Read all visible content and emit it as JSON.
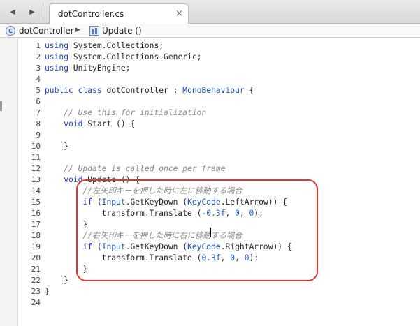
{
  "tab": {
    "filename": "dotController.cs",
    "close": "×"
  },
  "nav": {
    "back": "◀",
    "forward": "▶"
  },
  "breadcrumb": {
    "class_name": "dotController",
    "separator": "▶",
    "method_name": "Update ()"
  },
  "colors": {
    "keyword": "#1d3fbf",
    "comment": "#888888",
    "highlight": "#e53333"
  },
  "code": {
    "lines": [
      {
        "num": "1",
        "tokens": [
          {
            "t": "using",
            "c": "kw"
          },
          {
            "t": " System.Collections;",
            "c": ""
          }
        ]
      },
      {
        "num": "2",
        "tokens": [
          {
            "t": "using",
            "c": "kw"
          },
          {
            "t": " System.Collections.Generic;",
            "c": ""
          }
        ]
      },
      {
        "num": "3",
        "tokens": [
          {
            "t": "using",
            "c": "kw"
          },
          {
            "t": " UnityEngine;",
            "c": ""
          }
        ]
      },
      {
        "num": "4",
        "tokens": []
      },
      {
        "num": "5",
        "tokens": [
          {
            "t": "public",
            "c": "kw"
          },
          {
            "t": " ",
            "c": ""
          },
          {
            "t": "class",
            "c": "kw"
          },
          {
            "t": " dotController : ",
            "c": ""
          },
          {
            "t": "MonoBehaviour",
            "c": "ty"
          },
          {
            "t": " {",
            "c": ""
          }
        ]
      },
      {
        "num": "6",
        "tokens": []
      },
      {
        "num": "7",
        "tokens": [
          {
            "t": "    // Use this for initialization",
            "c": "cm"
          }
        ]
      },
      {
        "num": "8",
        "tokens": [
          {
            "t": "    ",
            "c": ""
          },
          {
            "t": "void",
            "c": "kw"
          },
          {
            "t": " Start () {",
            "c": ""
          }
        ]
      },
      {
        "num": "9",
        "tokens": []
      },
      {
        "num": "10",
        "tokens": [
          {
            "t": "    }",
            "c": ""
          }
        ]
      },
      {
        "num": "11",
        "tokens": []
      },
      {
        "num": "12",
        "tokens": [
          {
            "t": "    // Update is called once per frame",
            "c": "cm"
          }
        ]
      },
      {
        "num": "13",
        "tokens": [
          {
            "t": "    ",
            "c": ""
          },
          {
            "t": "void",
            "c": "kw"
          },
          {
            "t": " Update () {",
            "c": ""
          }
        ]
      },
      {
        "num": "14",
        "tokens": [
          {
            "t": "        //左矢印キーを押した時に左に移動する場合",
            "c": "cm"
          }
        ]
      },
      {
        "num": "15",
        "tokens": [
          {
            "t": "        ",
            "c": ""
          },
          {
            "t": "if",
            "c": "kw"
          },
          {
            "t": " (",
            "c": ""
          },
          {
            "t": "Input",
            "c": "ty"
          },
          {
            "t": ".GetKeyDown (",
            "c": ""
          },
          {
            "t": "KeyCode",
            "c": "ty"
          },
          {
            "t": ".LeftArrow)) {",
            "c": ""
          }
        ]
      },
      {
        "num": "16",
        "tokens": [
          {
            "t": "            transform.Translate (",
            "c": ""
          },
          {
            "t": "-0.3f",
            "c": "nm"
          },
          {
            "t": ", ",
            "c": ""
          },
          {
            "t": "0",
            "c": "nm"
          },
          {
            "t": ", ",
            "c": ""
          },
          {
            "t": "0",
            "c": "nm"
          },
          {
            "t": ");",
            "c": ""
          }
        ]
      },
      {
        "num": "17",
        "tokens": [
          {
            "t": "        }",
            "c": ""
          }
        ]
      },
      {
        "num": "18",
        "tokens": [
          {
            "t": "        //右矢印キーを押した時に右に移動する場合",
            "c": "cm"
          }
        ]
      },
      {
        "num": "19",
        "tokens": [
          {
            "t": "        ",
            "c": ""
          },
          {
            "t": "if",
            "c": "kw"
          },
          {
            "t": " (",
            "c": ""
          },
          {
            "t": "Input",
            "c": "ty"
          },
          {
            "t": ".GetKeyDown (",
            "c": ""
          },
          {
            "t": "KeyCode",
            "c": "ty"
          },
          {
            "t": ".RightArrow)) {",
            "c": ""
          }
        ]
      },
      {
        "num": "20",
        "tokens": [
          {
            "t": "            transform.Translate (",
            "c": ""
          },
          {
            "t": "0.3f",
            "c": "nm"
          },
          {
            "t": ", ",
            "c": ""
          },
          {
            "t": "0",
            "c": "nm"
          },
          {
            "t": ", ",
            "c": ""
          },
          {
            "t": "0",
            "c": "nm"
          },
          {
            "t": ");",
            "c": ""
          }
        ]
      },
      {
        "num": "21",
        "tokens": [
          {
            "t": "        }",
            "c": ""
          }
        ]
      },
      {
        "num": "22",
        "tokens": [
          {
            "t": "    }",
            "c": ""
          }
        ]
      },
      {
        "num": "23",
        "tokens": [
          {
            "t": "}",
            "c": ""
          }
        ]
      },
      {
        "num": "24",
        "tokens": []
      }
    ]
  }
}
